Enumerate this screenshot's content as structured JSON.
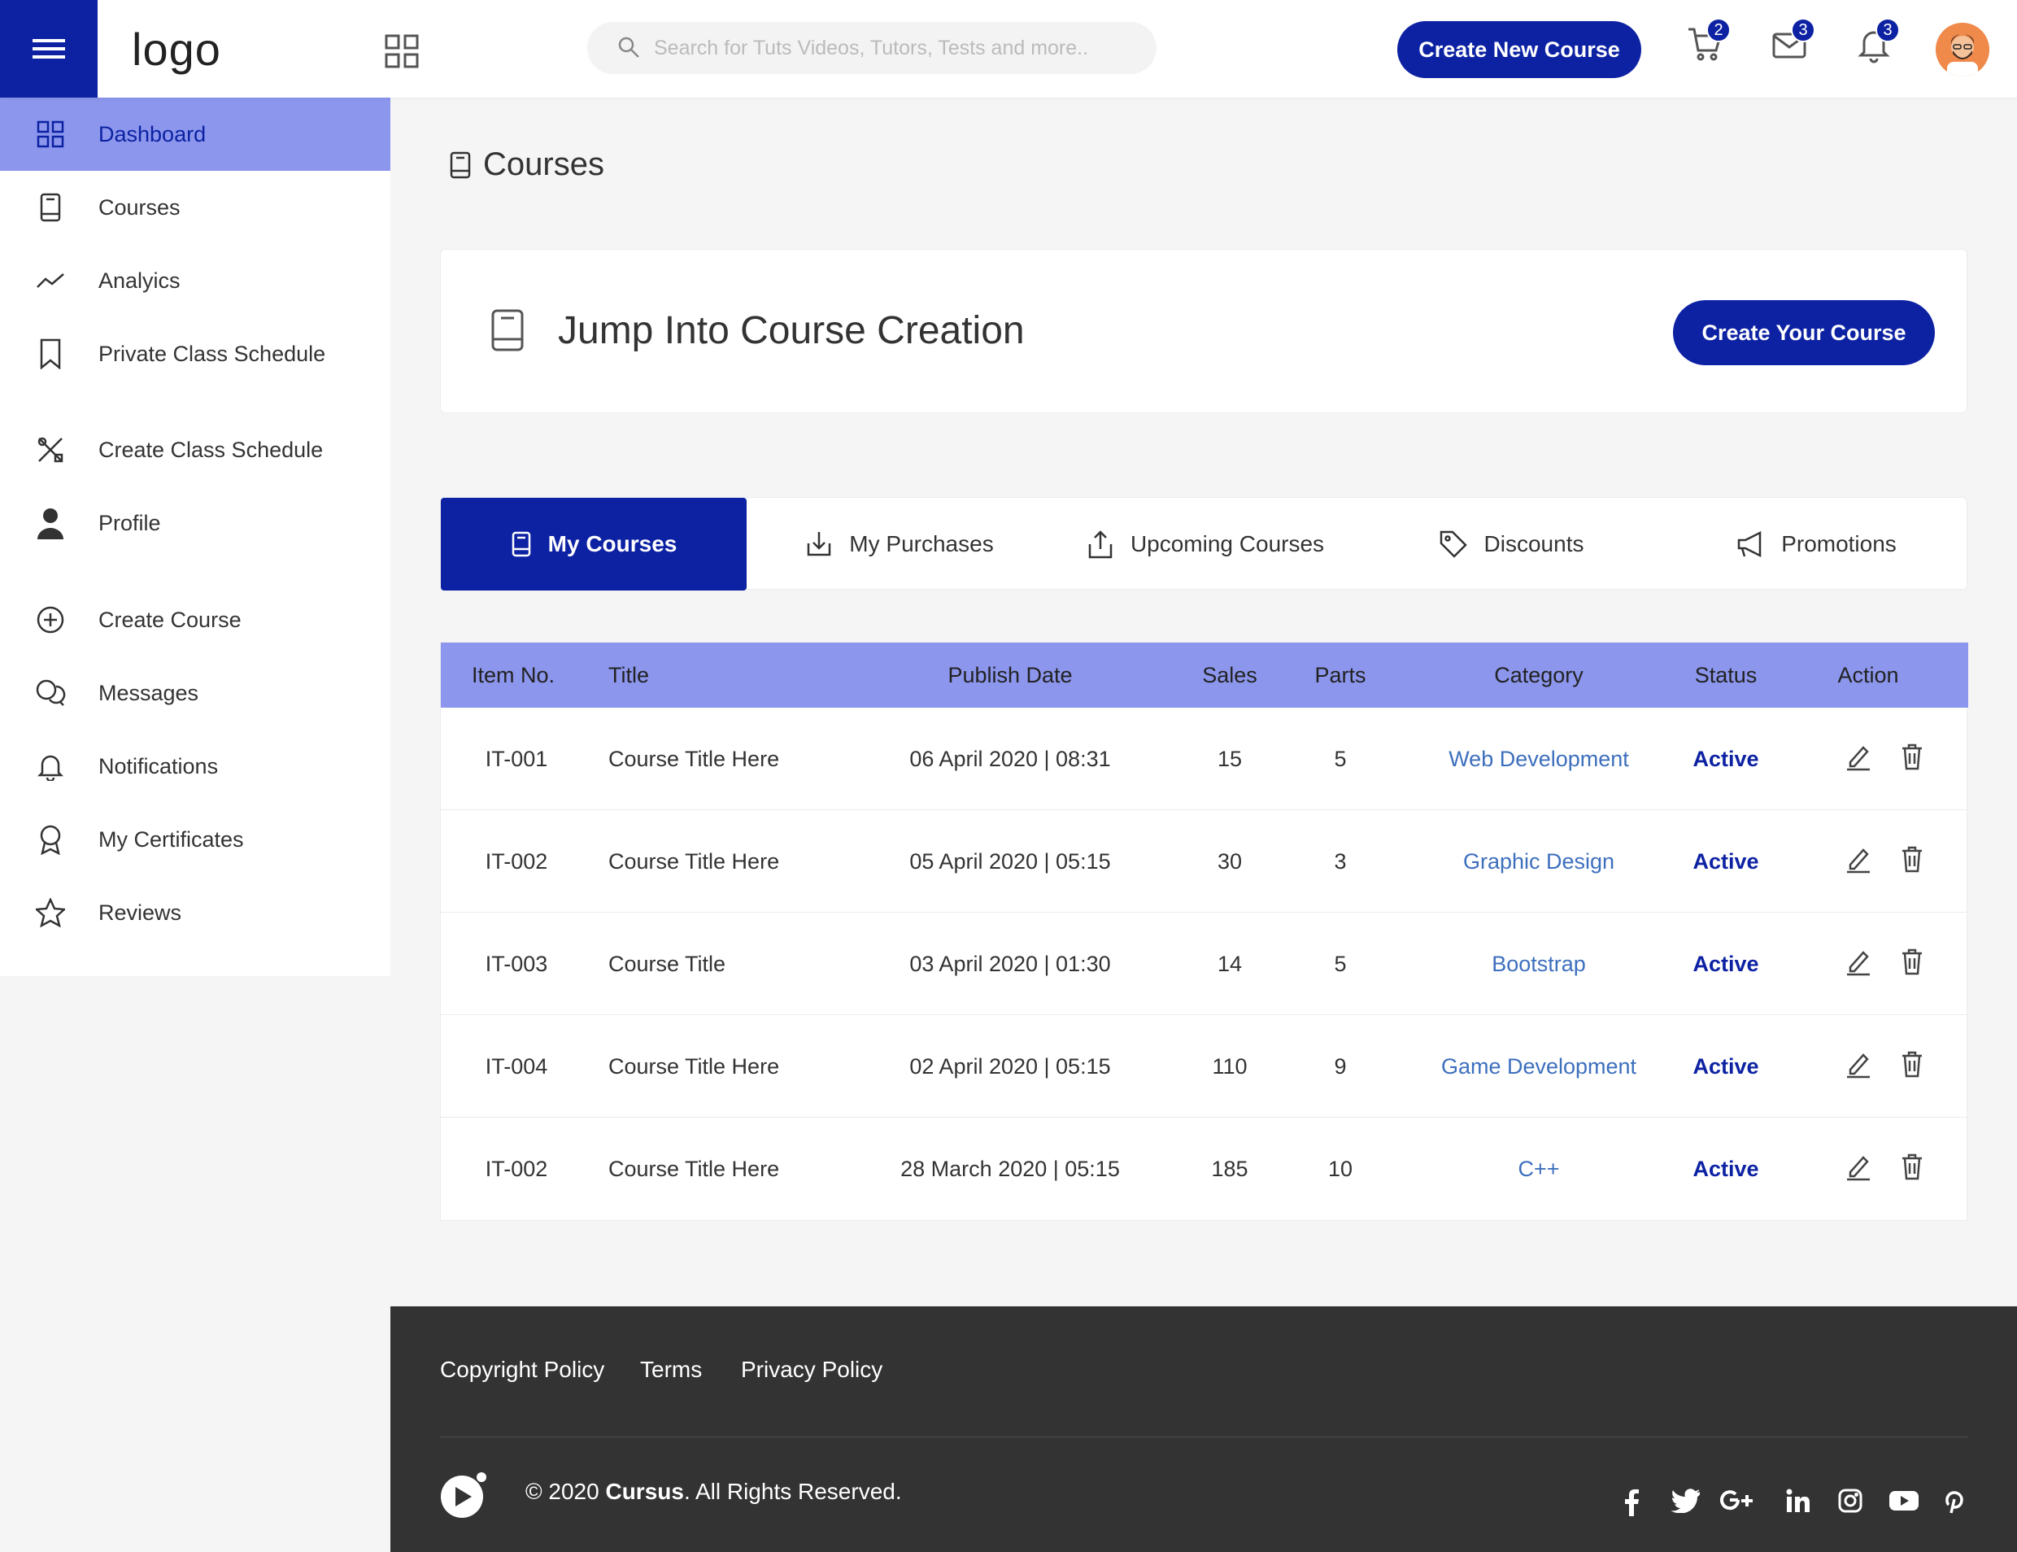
{
  "header": {
    "logo_text": "logo",
    "search_placeholder": "Search for Tuts Videos, Tutors, Tests and more..",
    "create_new_label": "Create New Course",
    "cart_count": "2",
    "mail_count": "3",
    "notification_count": "3",
    "icons": [
      "menu-icon",
      "apps-icon",
      "search-icon",
      "cart-icon",
      "mail-icon",
      "bell-icon",
      "avatar"
    ]
  },
  "sidebar": {
    "items": [
      {
        "label": "Dashboard",
        "icon": "dashboard-icon",
        "active": true
      },
      {
        "label": "Courses",
        "icon": "book-icon"
      },
      {
        "label": "Analyics",
        "icon": "analytics-icon"
      },
      {
        "label": "Private Class Schedule",
        "icon": "bookmark-icon"
      },
      {
        "label": "Create Class Schedule",
        "icon": "tools-icon"
      },
      {
        "label": "Profile",
        "icon": "user-icon"
      },
      {
        "label": "Create Course",
        "icon": "plus-circle-icon"
      },
      {
        "label": "Messages",
        "icon": "chat-icon"
      },
      {
        "label": "Notifications",
        "icon": "bell-icon"
      },
      {
        "label": "My Certificates",
        "icon": "award-icon"
      },
      {
        "label": "Reviews",
        "icon": "star-icon"
      }
    ]
  },
  "page": {
    "title": "Courses",
    "jump_title": "Jump Into Course Creation",
    "create_your_label": "Create Your Course"
  },
  "tabs": [
    {
      "label": "My Courses",
      "icon": "book-icon",
      "active": true
    },
    {
      "label": "My Purchases",
      "icon": "download-icon"
    },
    {
      "label": "Upcoming Courses",
      "icon": "upload-icon"
    },
    {
      "label": "Discounts",
      "icon": "tag-icon"
    },
    {
      "label": "Promotions",
      "icon": "megaphone-icon"
    }
  ],
  "table": {
    "headers": [
      "Item No.",
      "Title",
      "Publish Date",
      "Sales",
      "Parts",
      "Category",
      "Status",
      "Action"
    ],
    "rows": [
      [
        "IT-001",
        "Course Title Here",
        "06 April 2020 | 08:31",
        "15",
        "5",
        "Web Development",
        "Active"
      ],
      [
        "IT-002",
        "Course Title Here",
        "05 April 2020 | 05:15",
        "30",
        "3",
        "Graphic Design",
        "Active"
      ],
      [
        "IT-003",
        "Course Title",
        "03 April 2020 | 01:30",
        "14",
        "5",
        "Bootstrap",
        "Active"
      ],
      [
        "IT-004",
        "Course Title Here",
        "02 April 2020 | 05:15",
        "110",
        "9",
        "Game Development",
        "Active"
      ],
      [
        "IT-002",
        "Course Title Here",
        "28 March 2020 | 05:15",
        "185",
        "10",
        "C++",
        "Active"
      ]
    ]
  },
  "footer": {
    "links": [
      "Copyright Policy",
      "Terms",
      "Privacy Policy"
    ],
    "copyright_prefix": "© 2020 ",
    "brand": "Cursus",
    "copyright_suffix": ". All Rights Reserved.",
    "social": [
      "facebook-icon",
      "twitter-icon",
      "google-plus-icon",
      "linkedin-icon",
      "instagram-icon",
      "youtube-icon",
      "pinterest-icon"
    ]
  },
  "colors": {
    "primary": "#0d22a3",
    "accent": "#8b96ec",
    "category_link": "#3d6fbd",
    "footer_bg": "#333333"
  }
}
